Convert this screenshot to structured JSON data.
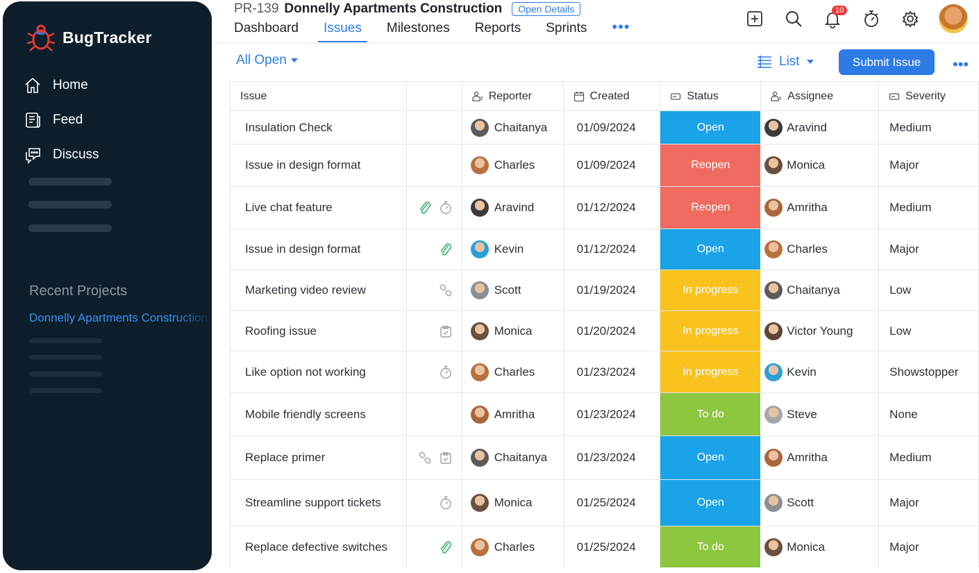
{
  "app": {
    "name": "BugTracker"
  },
  "sidebar": {
    "nav": [
      {
        "label": "Home",
        "icon": "home-icon"
      },
      {
        "label": "Feed",
        "icon": "feed-icon"
      },
      {
        "label": "Discuss",
        "icon": "discuss-icon"
      }
    ],
    "recent_title": "Recent Projects",
    "recent_projects": [
      "Donnelly Apartments Construction"
    ]
  },
  "header": {
    "project_id": "PR-139",
    "project_name": "Donnelly Apartments Construction",
    "open_details_label": "Open Details",
    "tabs": [
      {
        "label": "Dashboard",
        "active": false
      },
      {
        "label": "Issues",
        "active": true
      },
      {
        "label": "Milestones",
        "active": false
      },
      {
        "label": "Reports",
        "active": false
      },
      {
        "label": "Sprints",
        "active": false
      }
    ],
    "more_label": "•••",
    "notification_count": "10",
    "icons": [
      "add-icon",
      "search-icon",
      "bell-icon",
      "timer-icon",
      "settings-icon",
      "avatar"
    ]
  },
  "toolbar": {
    "filter_label": "All Open",
    "view_label": "List",
    "submit_label": "Submit Issue",
    "more_label": "•••"
  },
  "table": {
    "columns": [
      "Issue",
      "Reporter",
      "Created",
      "Status",
      "Assignee",
      "Severity"
    ],
    "status_colors": {
      "Open": "#1aa3e8",
      "Reopen": "#f06b5f",
      "In progress": "#f9c21e",
      "To do": "#8dc63f"
    },
    "rows": [
      {
        "issue": "Insulation Check",
        "icons": [],
        "reporter": "Chaitanya",
        "created": "01/09/2024",
        "status": "Open",
        "assignee": "Aravind",
        "severity": "Medium"
      },
      {
        "issue": "Issue in design format",
        "icons": [],
        "reporter": "Charles",
        "created": "01/09/2024",
        "status": "Reopen",
        "assignee": "Monica",
        "severity": "Major"
      },
      {
        "issue": "Live chat feature",
        "icons": [
          "attachment-icon",
          "timer-icon"
        ],
        "reporter": "Aravind",
        "created": "01/12/2024",
        "status": "Reopen",
        "assignee": "Amritha",
        "severity": "Medium"
      },
      {
        "issue": "Issue in design format",
        "icons": [
          "attachment-icon"
        ],
        "reporter": "Kevin",
        "created": "01/12/2024",
        "status": "Open",
        "assignee": "Charles",
        "severity": "Major"
      },
      {
        "issue": "Marketing video review",
        "icons": [
          "link-icon"
        ],
        "reporter": "Scott",
        "created": "01/19/2024",
        "status": "In progress",
        "assignee": "Chaitanya",
        "severity": "Low"
      },
      {
        "issue": "Roofing issue",
        "icons": [
          "task-icon"
        ],
        "reporter": "Monica",
        "created": "01/20/2024",
        "status": "In progress",
        "assignee": "Victor Young",
        "severity": "Low"
      },
      {
        "issue": "Like option not working",
        "icons": [
          "timer-icon"
        ],
        "reporter": "Charles",
        "created": "01/23/2024",
        "status": "In progress",
        "assignee": "Kevin",
        "severity": "Showstopper"
      },
      {
        "issue": "Mobile friendly screens",
        "icons": [],
        "reporter": "Amritha",
        "created": "01/23/2024",
        "status": "To do",
        "assignee": "Steve",
        "severity": "None"
      },
      {
        "issue": "Replace primer",
        "icons": [
          "link-icon",
          "task-icon"
        ],
        "reporter": "Chaitanya",
        "created": "01/23/2024",
        "status": "Open",
        "assignee": "Amritha",
        "severity": "Medium"
      },
      {
        "issue": "Streamline support tickets",
        "icons": [
          "timer-icon"
        ],
        "reporter": "Monica",
        "created": "01/25/2024",
        "status": "Open",
        "assignee": "Scott",
        "severity": "Major"
      },
      {
        "issue": "Replace defective switches",
        "icons": [
          "attachment-icon"
        ],
        "reporter": "Charles",
        "created": "01/25/2024",
        "status": "To do",
        "assignee": "Monica",
        "severity": "Major"
      }
    ]
  },
  "avatar_colors": {
    "Chaitanya": "#5b5b5b",
    "Charles": "#b9703f",
    "Aravind": "#3b3b3b",
    "Kevin": "#2a9fd8",
    "Scott": "#8a8f95",
    "Monica": "#6b4f3f",
    "Amritha": "#a8663a",
    "Victor Young": "#5a4638",
    "Steve": "#a3a8ad"
  }
}
